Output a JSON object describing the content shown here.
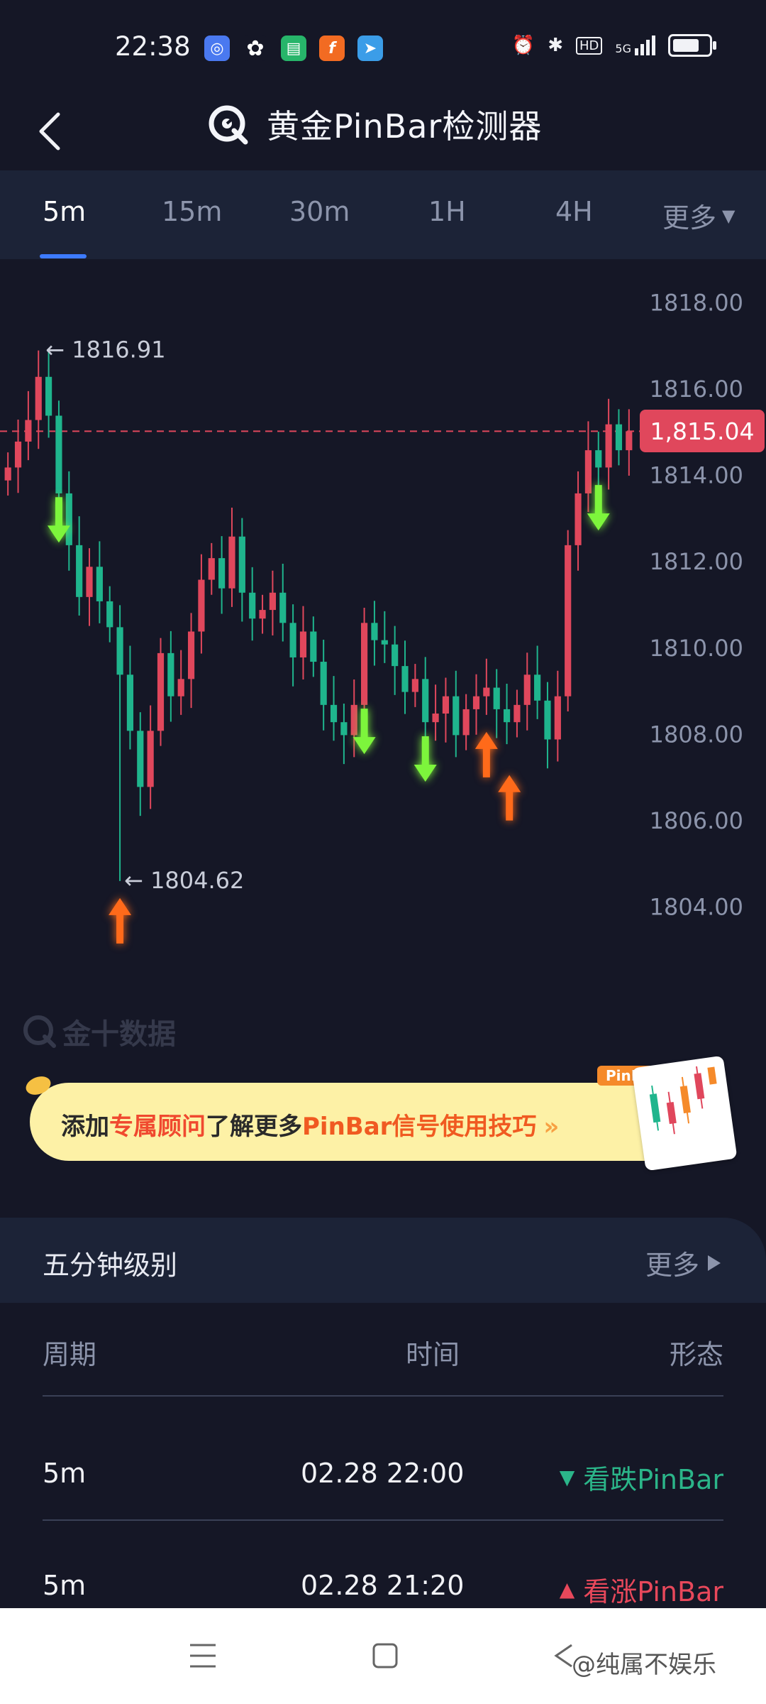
{
  "status_bar": {
    "time": "22:38",
    "apps": [
      {
        "icon": "search-app-icon",
        "color": "#4a79f0",
        "glyph": "◎"
      },
      {
        "icon": "wechat-icon",
        "color": "#ffffff",
        "glyph": "✦"
      },
      {
        "icon": "chat-app-icon",
        "color": "#27b56a",
        "glyph": "▣"
      },
      {
        "icon": "f-app-icon",
        "color": "#f26b22",
        "glyph": "f"
      },
      {
        "icon": "send-app-icon",
        "color": "#3b9de8",
        "glyph": "➤"
      }
    ],
    "signal_text": "5G",
    "hd_text": "HD"
  },
  "header": {
    "title": "黄金PinBar检测器"
  },
  "tabs": [
    {
      "label": "5m",
      "active": true
    },
    {
      "label": "15m",
      "active": false
    },
    {
      "label": "30m",
      "active": false
    },
    {
      "label": "1H",
      "active": false
    },
    {
      "label": "4H",
      "active": false
    },
    {
      "label": "更多",
      "active": false
    }
  ],
  "chart_data": {
    "type": "candlestick",
    "y_axis_ticks": [
      "1818.00",
      "1816.00",
      "1814.00",
      "1812.00",
      "1810.00",
      "1808.00",
      "1806.00",
      "1804.00"
    ],
    "ylim": [
      1803.5,
      1818.5
    ],
    "current_price": "1,815.04",
    "current_price_value": 1815.04,
    "high_annotation": "1816.91",
    "high_value": 1816.91,
    "low_annotation": "1804.62",
    "low_value": 1804.62,
    "colors": {
      "up": "#e0475c",
      "down": "#1fb58d",
      "bearish_signal": "#7df53c",
      "bullish_signal": "#ff6a1a"
    },
    "closes": [
      1814.2,
      1814.8,
      1815.3,
      1816.3,
      1815.4,
      1813.6,
      1812.4,
      1811.2,
      1811.9,
      1811.1,
      1810.5,
      1809.4,
      1808.1,
      1806.8,
      1808.1,
      1809.9,
      1808.9,
      1809.3,
      1810.4,
      1811.6,
      1812.1,
      1811.4,
      1812.6,
      1811.3,
      1810.7,
      1810.9,
      1811.3,
      1810.6,
      1809.8,
      1810.4,
      1809.7,
      1808.7,
      1808.3,
      1808.0,
      1808.7,
      1810.6,
      1810.2,
      1810.1,
      1809.6,
      1809.0,
      1809.3,
      1808.3,
      1808.5,
      1808.9,
      1808.0,
      1808.6,
      1808.9,
      1809.1,
      1808.6,
      1808.3,
      1808.7,
      1809.4,
      1808.8,
      1807.9,
      1808.9,
      1812.4,
      1813.6,
      1814.6,
      1814.2,
      1815.2,
      1814.6,
      1815.04
    ],
    "bearish_signal_bars": [
      5,
      35,
      41,
      58
    ],
    "bullish_signal_bars": [
      11,
      47,
      48
    ]
  },
  "watermark": "金十数据",
  "banner": {
    "part1": "添加",
    "part2": "专属顾问",
    "part3": "了解更多",
    "part4": "PinBar信号使用技巧",
    "chevrons": "»",
    "tag": "PinBar"
  },
  "section": {
    "title": "五分钟级别",
    "more_label": "更多"
  },
  "table": {
    "headers": [
      "周期",
      "时间",
      "形态"
    ],
    "rows": [
      {
        "period": "5m",
        "time": "02.28 22:00",
        "pattern": "看跌PinBar",
        "direction": "down",
        "marker": "▼"
      },
      {
        "period": "5m",
        "time": "02.28 21:20",
        "pattern": "看涨PinBar",
        "direction": "up",
        "marker": "▲"
      }
    ]
  },
  "navbar": {
    "watermark": "@纯属不娱乐"
  }
}
